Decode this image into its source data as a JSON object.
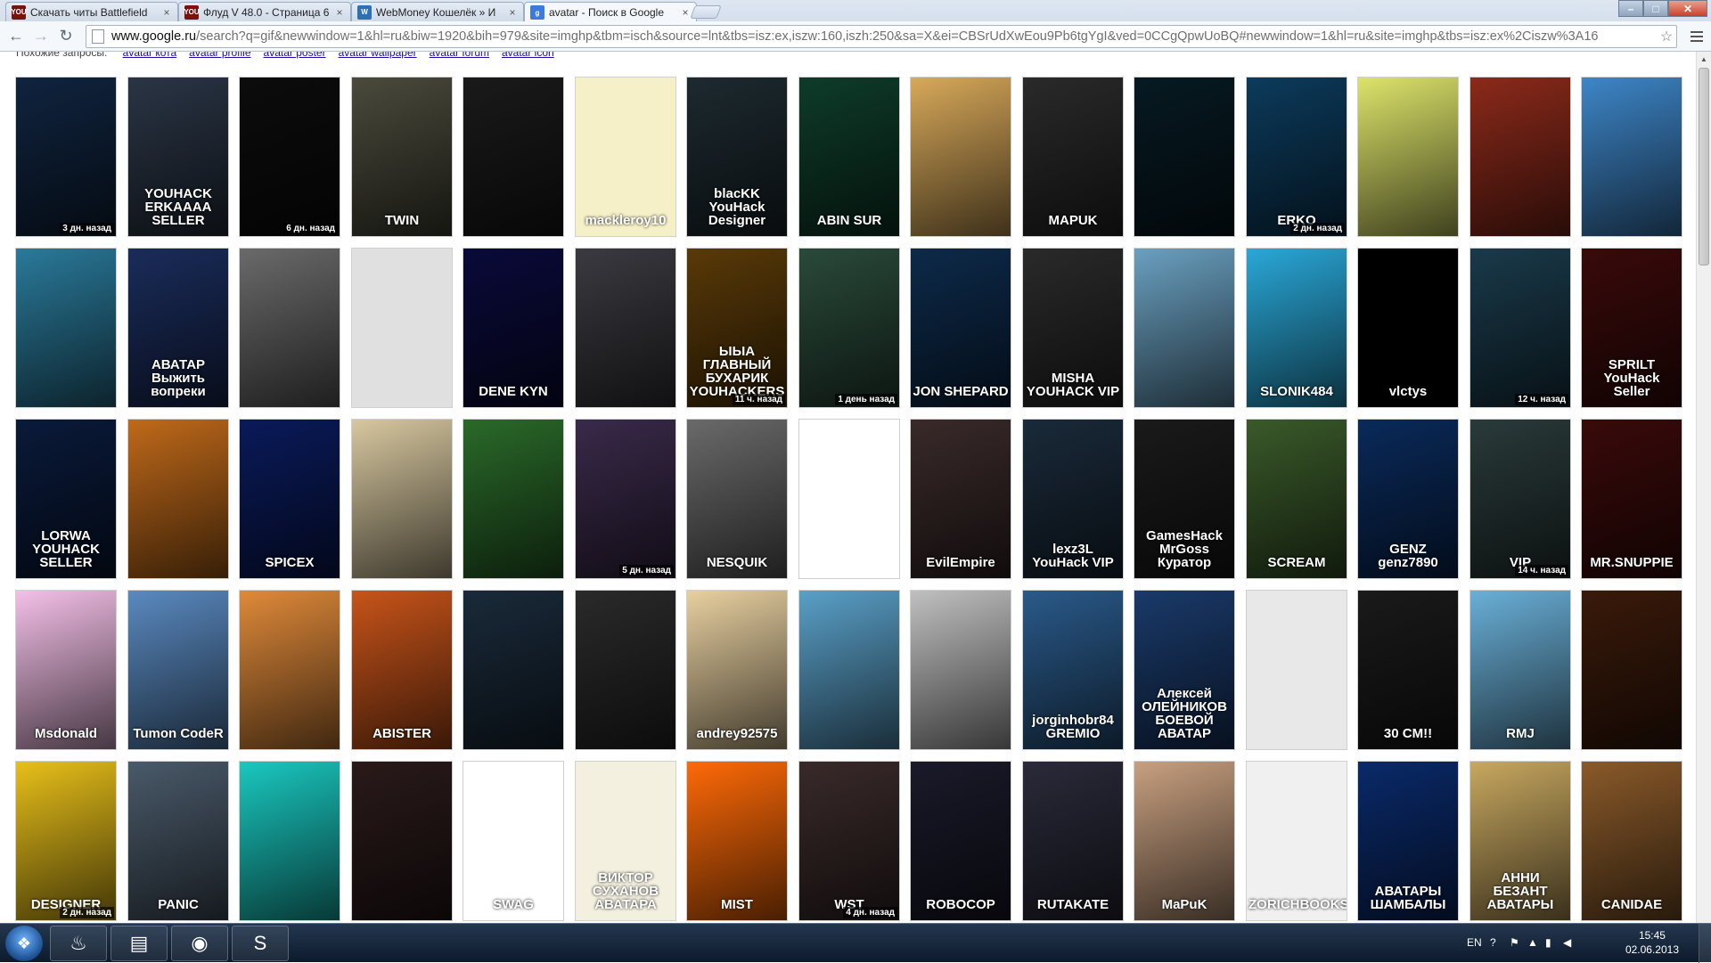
{
  "browser": {
    "tabs": [
      {
        "label": "Скачать читы Battlefield",
        "favicon": "YOU",
        "favicon_color": "#7a1010",
        "close": "×"
      },
      {
        "label": "Флуд V 48.0 - Страница 6",
        "favicon": "YOU",
        "favicon_color": "#7a1010",
        "close": "×"
      },
      {
        "label": "WebMoney Кошелёк » И",
        "favicon": "W",
        "favicon_color": "#2f6fb5",
        "close": "×"
      },
      {
        "label": "avatar - Поиск в Google",
        "favicon": "g",
        "favicon_color": "#3b7be0",
        "close": "×"
      }
    ],
    "window_controls": {
      "minimize": "–",
      "maximize": "□",
      "close": "✕"
    },
    "back": "←",
    "forward": "→",
    "reload": "↻",
    "url_host": "www.google.ru",
    "url_rest": "/search?q=gif&newwindow=1&hl=ru&biw=1920&bih=979&site=imghp&tbm=isch&source=lnt&tbs=isz:ex,iszw:160,iszh:250&sa=X&ei=CBSrUdXwEou9Pb6tgYgI&ved=0CCgQpwUoBQ#newwindow=1&hl=ru&site=imghp&tbs=isz:ex%2Ciszw%3A16",
    "bookmark_star": "☆"
  },
  "related": {
    "label": "Похожие запросы:",
    "links": [
      "avatar кота",
      "avatar profile",
      "avatar poster",
      "avatar wallpaper",
      "avatar forum",
      "avatar icon"
    ]
  },
  "tiles": [
    [
      {
        "bg": "#10243f",
        "cap": "",
        "time": "3 дн. назад"
      },
      {
        "bg": "#2a3545",
        "cap": "YOUHACK ERKAAAA SELLER",
        "time": ""
      },
      {
        "bg": "#0c0c0c",
        "cap": "",
        "time": "6 дн. назад"
      },
      {
        "bg": "#4a4a3c",
        "cap": "TWIN",
        "time": ""
      },
      {
        "bg": "#1a1a1a",
        "cap": "",
        "time": ""
      },
      {
        "bg": "#f6f0c8",
        "cap": "mackleroy10",
        "time": ""
      },
      {
        "bg": "#1d2a30",
        "cap": "blacKK YouHack Designer",
        "time": ""
      },
      {
        "bg": "#0e3c2a",
        "cap": "ABIN SUR",
        "time": ""
      },
      {
        "bg": "#d8a95a",
        "cap": "",
        "time": ""
      },
      {
        "bg": "#2a2a2a",
        "cap": "MAPUK",
        "time": ""
      },
      {
        "bg": "#071a22",
        "cap": "",
        "time": ""
      },
      {
        "bg": "#0c3b5c",
        "cap": "ERKO",
        "time": "2 дн. назад"
      },
      {
        "bg": "#dde46a",
        "cap": "",
        "time": ""
      },
      {
        "bg": "#8c2a1a",
        "cap": "",
        "time": ""
      },
      {
        "bg": "#3e86c8",
        "cap": "",
        "time": ""
      }
    ],
    [
      {
        "bg": "#2a7a9a",
        "cap": "",
        "time": ""
      },
      {
        "bg": "#1a2c5a",
        "cap": "АВАТАР Выжить вопреки",
        "time": ""
      },
      {
        "bg": "#6a6a6a",
        "cap": "",
        "time": ""
      },
      {
        "bg": "#e0e0e0",
        "cap": "",
        "time": ""
      },
      {
        "bg": "#0a0a3a",
        "cap": "DENE KYN",
        "time": ""
      },
      {
        "bg": "#3a3a40",
        "cap": "",
        "time": ""
      },
      {
        "bg": "#5a3a08",
        "cap": "ЫЫА ГЛАВНЫЙ БУХАРИК YOUHACKERS",
        "time": "11 ч. назад"
      },
      {
        "bg": "#2a4a3a",
        "cap": "",
        "time": "1 день назад"
      },
      {
        "bg": "#0d2a4a",
        "cap": "JON SHEPARD",
        "time": ""
      },
      {
        "bg": "#2a2a2a",
        "cap": "MISHA YOUHACK VIP",
        "time": ""
      },
      {
        "bg": "#6aa0c0",
        "cap": "",
        "time": ""
      },
      {
        "bg": "#2aa8d8",
        "cap": "SLONIK484",
        "time": ""
      },
      {
        "bg": "#000000",
        "cap": "vlctys",
        "time": ""
      },
      {
        "bg": "#1a3a4a",
        "cap": "",
        "time": "12 ч. назад"
      },
      {
        "bg": "#3a0a0a",
        "cap": "SPRILT YouHack Seller",
        "time": ""
      }
    ],
    [
      {
        "bg": "#0a1a3a",
        "cap": "LORWA YOUHACK SELLER",
        "time": ""
      },
      {
        "bg": "#c06a1a",
        "cap": "",
        "time": ""
      },
      {
        "bg": "#0a1a5a",
        "cap": "SPICEX",
        "time": ""
      },
      {
        "bg": "#d8c8a0",
        "cap": "",
        "time": ""
      },
      {
        "bg": "#2a6a2a",
        "cap": "",
        "time": ""
      },
      {
        "bg": "#3a2a4a",
        "cap": "",
        "time": "5 дн. назад"
      },
      {
        "bg": "#6a6a6a",
        "cap": "NESQUIK",
        "time": ""
      },
      {
        "bg": "#ffffff",
        "cap": "",
        "time": ""
      },
      {
        "bg": "#3a2a2a",
        "cap": "EvilEmpire",
        "time": ""
      },
      {
        "bg": "#1a2a3a",
        "cap": "lexz3L YouHack VIP",
        "time": ""
      },
      {
        "bg": "#1a1a1a",
        "cap": "GamesHack MrGoss Куратор",
        "time": ""
      },
      {
        "bg": "#3a5a2a",
        "cap": "SCREAM",
        "time": ""
      },
      {
        "bg": "#0a2a5a",
        "cap": "GENZ genz7890",
        "time": ""
      },
      {
        "bg": "#2a3a3a",
        "cap": "VIP",
        "time": "14 ч. назад"
      },
      {
        "bg": "#3a0a0a",
        "cap": "MR.SNUPPIE",
        "time": ""
      }
    ],
    [
      {
        "bg": "#f4c0e8",
        "cap": "Msdonald",
        "time": ""
      },
      {
        "bg": "#5a8ac0",
        "cap": "Tumon CodeR",
        "time": ""
      },
      {
        "bg": "#e08a3a",
        "cap": "",
        "time": ""
      },
      {
        "bg": "#c8541a",
        "cap": "ABISTER",
        "time": ""
      },
      {
        "bg": "#1a2a3a",
        "cap": "",
        "time": ""
      },
      {
        "bg": "#2a2a2a",
        "cap": "",
        "time": ""
      },
      {
        "bg": "#e8d0a0",
        "cap": "andrey92575",
        "time": ""
      },
      {
        "bg": "#5aa0c8",
        "cap": "",
        "time": ""
      },
      {
        "bg": "#c0c0c0",
        "cap": "",
        "time": ""
      },
      {
        "bg": "#2a5a8a",
        "cap": "jorginhobr84 GREMIO",
        "time": ""
      },
      {
        "bg": "#1a3a6a",
        "cap": "Алексей ОЛЕЙНИКОВ БОЕВОЙ АВАТАР",
        "time": ""
      },
      {
        "bg": "#e8e8e8",
        "cap": "",
        "time": ""
      },
      {
        "bg": "#1a1a1a",
        "cap": "30 CM!!",
        "time": ""
      },
      {
        "bg": "#6ab0d8",
        "cap": "RMJ",
        "time": ""
      },
      {
        "bg": "#3a1a0a",
        "cap": "",
        "time": ""
      }
    ],
    [
      {
        "bg": "#e8c01a",
        "cap": "DESIGNER",
        "time": "2 дн. назад"
      },
      {
        "bg": "#4a5a6a",
        "cap": "PANIC",
        "time": ""
      },
      {
        "bg": "#1ac8c0",
        "cap": "",
        "time": ""
      },
      {
        "bg": "#2a1a1a",
        "cap": "",
        "time": ""
      },
      {
        "bg": "#ffffff",
        "cap": "SWAG",
        "time": ""
      },
      {
        "bg": "#f4f0e0",
        "cap": "ВИКТОР СУХАНОВ АВАТАРА",
        "time": ""
      },
      {
        "bg": "#ff6a08",
        "cap": "MIST",
        "time": ""
      },
      {
        "bg": "#3a2a2a",
        "cap": "WST",
        "time": "4 дн. назад"
      },
      {
        "bg": "#1a1a2a",
        "cap": "ROBOCOP",
        "time": ""
      },
      {
        "bg": "#2a2a3a",
        "cap": "RUTAKATE",
        "time": ""
      },
      {
        "bg": "#c8a080",
        "cap": "MaPuK",
        "time": ""
      },
      {
        "bg": "#f0f0f0",
        "cap": "ZORICHBOOKS.COM",
        "time": ""
      },
      {
        "bg": "#0a2a6a",
        "cap": "АВАТАРЫ ШАМБАЛЫ",
        "time": ""
      },
      {
        "bg": "#c8a860",
        "cap": "АННИ БЕЗАНТ АВАТАРЫ",
        "time": ""
      },
      {
        "bg": "#8a5a2a",
        "cap": "CANIDAE",
        "time": ""
      }
    ]
  ],
  "taskbar": {
    "start": "❖",
    "apps": [
      {
        "name": "steam",
        "glyph": "♨"
      },
      {
        "name": "explorer",
        "glyph": "▤"
      },
      {
        "name": "chrome",
        "glyph": "◉"
      },
      {
        "name": "skype",
        "glyph": "S"
      }
    ],
    "lang": "EN",
    "time": "15:45",
    "date": "02.06.2013"
  }
}
